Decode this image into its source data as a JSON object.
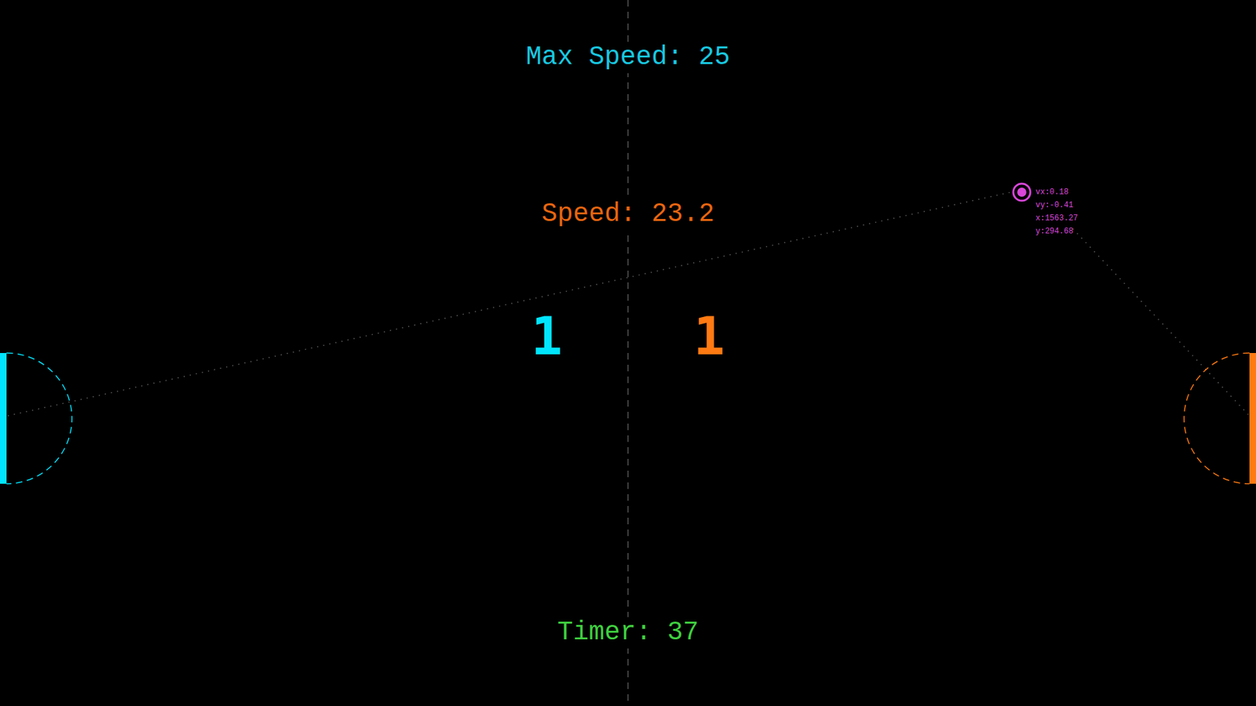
{
  "hud": {
    "max_speed": "Max Speed: 25",
    "speed": "Speed: 23.2",
    "timer": "Timer: 37"
  },
  "players": [
    {
      "side": "left",
      "score": "1",
      "color": "#00e5ff"
    },
    {
      "side": "right",
      "score": "1",
      "color": "#ff7a12"
    }
  ],
  "ball": {
    "color": "#d946d9",
    "readouts": [
      "vx:0.18",
      "vy:-0.41",
      "x:1563.27",
      "y:294.68"
    ]
  }
}
